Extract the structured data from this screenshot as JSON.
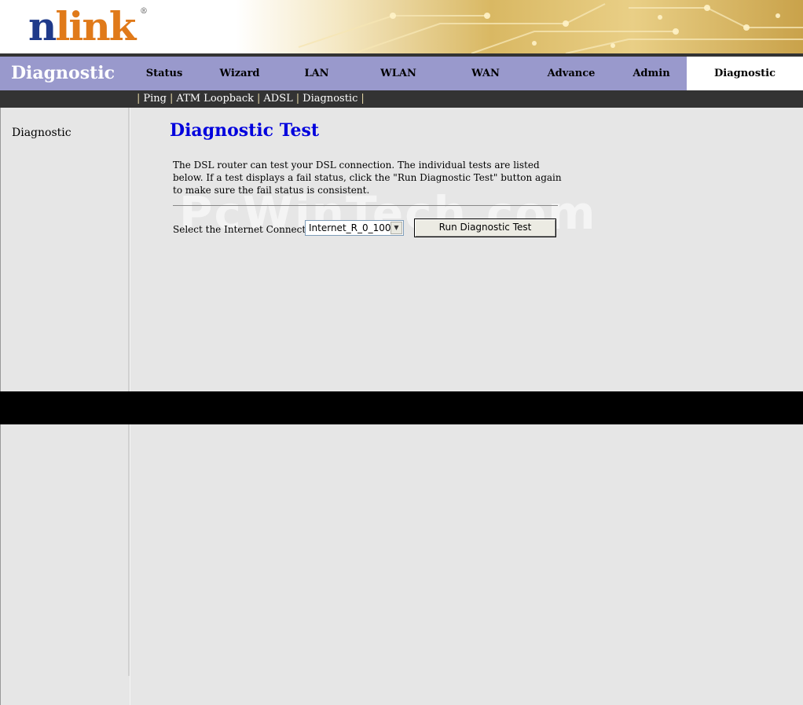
{
  "brand": {
    "logo_n": "n",
    "logo_rest": "link",
    "logo_reg": "®"
  },
  "nav": {
    "section_title": "Diagnostic",
    "tabs": [
      {
        "label": "Status"
      },
      {
        "label": "Wizard"
      },
      {
        "label": "LAN"
      },
      {
        "label": "WLAN"
      },
      {
        "label": "WAN"
      },
      {
        "label": "Advance"
      },
      {
        "label": "Admin"
      },
      {
        "label": "Diagnostic",
        "active": true
      }
    ]
  },
  "subnav": {
    "items": [
      {
        "label": "Ping"
      },
      {
        "label": "ATM Loopback"
      },
      {
        "label": "ADSL"
      },
      {
        "label": "Diagnostic"
      }
    ],
    "separator": "|"
  },
  "sidebar": {
    "items": [
      {
        "label": "Diagnostic"
      }
    ]
  },
  "main": {
    "title": "Diagnostic Test",
    "description": "The DSL router can test your DSL connection. The individual tests are listed below. If a test displays a fail status, click the \"Run Diagnostic Test\" button again to make sure the fail status is consistent.",
    "connection_label": "Select the Internet Connection:",
    "connection_value": "Internet_R_0_100",
    "run_button_label": "Run Diagnostic Test",
    "watermark": "PcWinTech.com"
  },
  "colors": {
    "nav_bg": "#9999cc",
    "subnav_bg": "#333333",
    "title": "#0000dd",
    "logo_blue": "#1f3a8a",
    "logo_orange": "#e07a1a"
  }
}
